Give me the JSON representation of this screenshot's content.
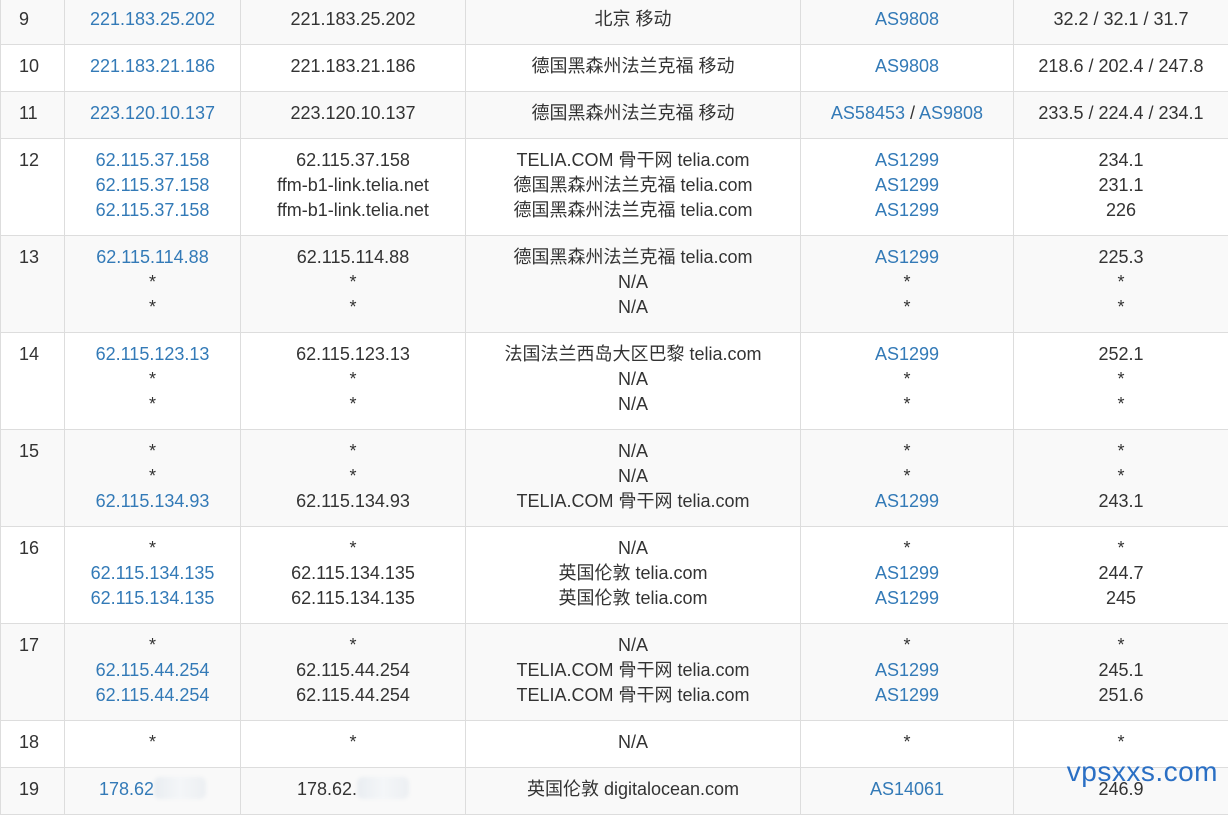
{
  "rows": [
    {
      "hop": "9",
      "ips": [
        "221.183.25.202"
      ],
      "hosts": [
        "221.183.25.202"
      ],
      "locations": [
        "北京 移动"
      ],
      "asns": [
        [
          "AS9808"
        ]
      ],
      "latencies": [
        "32.2 / 32.1 / 31.7"
      ]
    },
    {
      "hop": "10",
      "ips": [
        "221.183.21.186"
      ],
      "hosts": [
        "221.183.21.186"
      ],
      "locations": [
        "德国黑森州法兰克福 移动"
      ],
      "asns": [
        [
          "AS9808"
        ]
      ],
      "latencies": [
        "218.6 / 202.4 / 247.8"
      ]
    },
    {
      "hop": "11",
      "ips": [
        "223.120.10.137"
      ],
      "hosts": [
        "223.120.10.137"
      ],
      "locations": [
        "德国黑森州法兰克福 移动"
      ],
      "asns": [
        [
          "AS58453",
          "AS9808"
        ]
      ],
      "latencies": [
        "233.5 / 224.4 / 234.1"
      ]
    },
    {
      "hop": "12",
      "ips": [
        "62.115.37.158",
        "62.115.37.158",
        "62.115.37.158"
      ],
      "hosts": [
        "62.115.37.158",
        "ffm-b1-link.telia.net",
        "ffm-b1-link.telia.net"
      ],
      "locations": [
        "TELIA.COM 骨干网 telia.com",
        "德国黑森州法兰克福 telia.com",
        "德国黑森州法兰克福 telia.com"
      ],
      "asns": [
        [
          "AS1299"
        ],
        [
          "AS1299"
        ],
        [
          "AS1299"
        ]
      ],
      "latencies": [
        "234.1",
        "231.1",
        "226"
      ]
    },
    {
      "hop": "13",
      "ips": [
        "62.115.114.88",
        "*",
        "*"
      ],
      "hosts": [
        "62.115.114.88",
        "*",
        "*"
      ],
      "locations": [
        "德国黑森州法兰克福 telia.com",
        "N/A",
        "N/A"
      ],
      "asns": [
        [
          "AS1299"
        ],
        [
          "*"
        ],
        [
          "*"
        ]
      ],
      "latencies": [
        "225.3",
        "*",
        "*"
      ]
    },
    {
      "hop": "14",
      "ips": [
        "62.115.123.13",
        "*",
        "*"
      ],
      "hosts": [
        "62.115.123.13",
        "*",
        "*"
      ],
      "locations": [
        "法国法兰西岛大区巴黎 telia.com",
        "N/A",
        "N/A"
      ],
      "asns": [
        [
          "AS1299"
        ],
        [
          "*"
        ],
        [
          "*"
        ]
      ],
      "latencies": [
        "252.1",
        "*",
        "*"
      ]
    },
    {
      "hop": "15",
      "ips": [
        "*",
        "*",
        "62.115.134.93"
      ],
      "hosts": [
        "*",
        "*",
        "62.115.134.93"
      ],
      "locations": [
        "N/A",
        "N/A",
        "TELIA.COM 骨干网 telia.com"
      ],
      "asns": [
        [
          "*"
        ],
        [
          "*"
        ],
        [
          "AS1299"
        ]
      ],
      "latencies": [
        "*",
        "*",
        "243.1"
      ]
    },
    {
      "hop": "16",
      "ips": [
        "*",
        "62.115.134.135",
        "62.115.134.135"
      ],
      "hosts": [
        "*",
        "62.115.134.135",
        "62.115.134.135"
      ],
      "locations": [
        "N/A",
        "英国伦敦 telia.com",
        "英国伦敦 telia.com"
      ],
      "asns": [
        [
          "*"
        ],
        [
          "AS1299"
        ],
        [
          "AS1299"
        ]
      ],
      "latencies": [
        "*",
        "244.7",
        "245"
      ]
    },
    {
      "hop": "17",
      "ips": [
        "*",
        "62.115.44.254",
        "62.115.44.254"
      ],
      "hosts": [
        "*",
        "62.115.44.254",
        "62.115.44.254"
      ],
      "locations": [
        "N/A",
        "TELIA.COM 骨干网 telia.com",
        "TELIA.COM 骨干网 telia.com"
      ],
      "asns": [
        [
          "*"
        ],
        [
          "AS1299"
        ],
        [
          "AS1299"
        ]
      ],
      "latencies": [
        "*",
        "245.1",
        "251.6"
      ]
    },
    {
      "hop": "18",
      "ips": [
        "*"
      ],
      "hosts": [
        "*"
      ],
      "locations": [
        "N/A"
      ],
      "asns": [
        [
          "*"
        ]
      ],
      "latencies": [
        "*"
      ]
    },
    {
      "hop": "19",
      "ips": [
        "178.62"
      ],
      "hosts": [
        "178.62."
      ],
      "locations": [
        "英国伦敦 digitalocean.com"
      ],
      "asns": [
        [
          "AS14061"
        ]
      ],
      "latencies": [
        "246.9"
      ]
    }
  ],
  "colors": {
    "link": "#337ab7",
    "text": "#333333",
    "border": "#dddddd",
    "stripe": "#f9f9f9",
    "watermark": "#2a6fc4"
  },
  "watermark": "vpsxxs.com"
}
